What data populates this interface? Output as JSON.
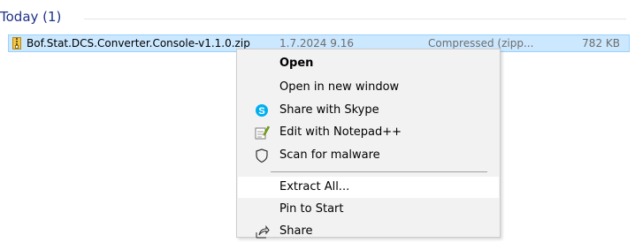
{
  "group": {
    "title": "Today (1)"
  },
  "file": {
    "name": "Bof.Stat.DCS.Converter.Console-v1.1.0.zip",
    "date": "1.7.2024 9.16",
    "type": "Compressed (zipp...",
    "size": "782 KB"
  },
  "context_menu": {
    "items": [
      {
        "label": "Open",
        "icon": ""
      },
      {
        "label": "Open in new window",
        "icon": ""
      },
      {
        "label": "Share with Skype",
        "icon": "skype-icon"
      },
      {
        "label": "Edit with Notepad++",
        "icon": "notepadplusplus-icon"
      },
      {
        "label": "Scan for malware",
        "icon": "shield-icon"
      },
      {
        "label": "Extract All...",
        "icon": ""
      },
      {
        "label": "Pin to Start",
        "icon": ""
      },
      {
        "label": "Share",
        "icon": "share-icon"
      }
    ]
  },
  "colors": {
    "selection": "#cce8ff",
    "group_title": "#1e3287",
    "skype": "#00aff0"
  }
}
